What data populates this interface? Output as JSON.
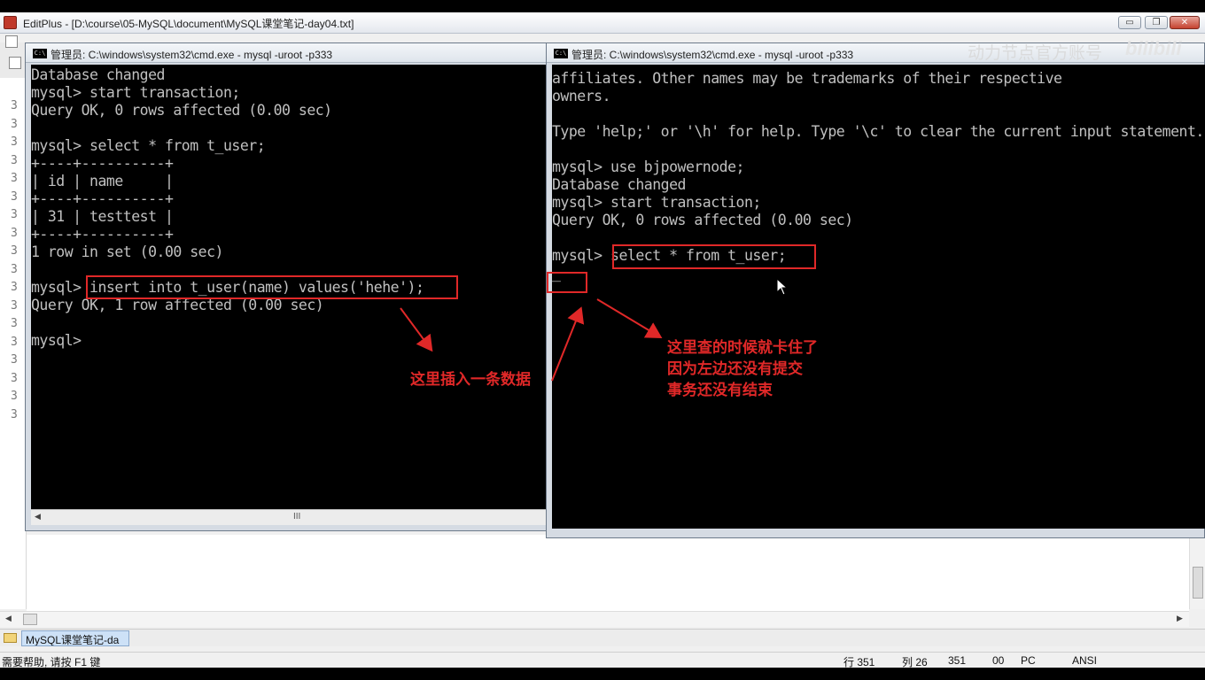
{
  "editplus": {
    "title": "EditPlus - [D:\\course\\05-MySQL\\document\\MySQL课堂笔记-day04.txt]",
    "window_buttons": {
      "minimize": "▭",
      "restore": "❐",
      "close": "✕"
    },
    "gutter_lines": [
      "3",
      "3",
      "3",
      "3",
      "3",
      "3",
      "3",
      "3",
      "3",
      "3",
      "3",
      "3",
      "3",
      "3",
      "3",
      "3",
      "3",
      "3"
    ],
    "tab_label": "MySQL课堂笔记-da",
    "status": {
      "help": "需要帮助, 请按 F1 键",
      "line": "行 351",
      "col": "列 26",
      "num": "351",
      "code": "00",
      "eol": "PC",
      "encoding": "ANSI"
    },
    "hscroll_grip": "III"
  },
  "cmd_left": {
    "title": "管理员: C:\\windows\\system32\\cmd.exe - mysql  -uroot -p333",
    "icon": "C:\\",
    "lines": [
      "Database changed",
      "mysql> start transaction;",
      "Query OK, 0 rows affected (0.00 sec)",
      "",
      "mysql> select * from t_user;",
      "+----+----------+",
      "| id | name     |",
      "+----+----------+",
      "| 31 | testtest |",
      "+----+----------+",
      "1 row in set (0.00 sec)",
      "",
      "mysql> insert into t_user(name) values('hehe');",
      "Query OK, 1 row affected (0.00 sec)",
      "",
      "mysql>"
    ]
  },
  "cmd_right": {
    "title": "管理员: C:\\windows\\system32\\cmd.exe - mysql  -uroot -p333",
    "icon": "C:\\",
    "lines": [
      "affiliates. Other names may be trademarks of their respective",
      "owners.",
      "",
      "Type 'help;' or '\\h' for help. Type '\\c' to clear the current input statement.",
      "",
      "mysql> use bjpowernode;",
      "Database changed",
      "mysql> start transaction;",
      "Query OK, 0 rows affected (0.00 sec)",
      "",
      "mysql> select * from t_user;",
      "_"
    ]
  },
  "annotations": {
    "left_note": "这里插入一条数据",
    "right_note": [
      "这里查的时候就卡住了",
      "因为左边还没有提交",
      "事务还没有结束"
    ],
    "color": "#e02828"
  },
  "watermark": {
    "text": "动力节点官方账号",
    "logo": "bilibili"
  },
  "colors": {
    "console_bg": "#000000",
    "console_fg": "#c0c0c0",
    "highlight": "#e02828"
  }
}
